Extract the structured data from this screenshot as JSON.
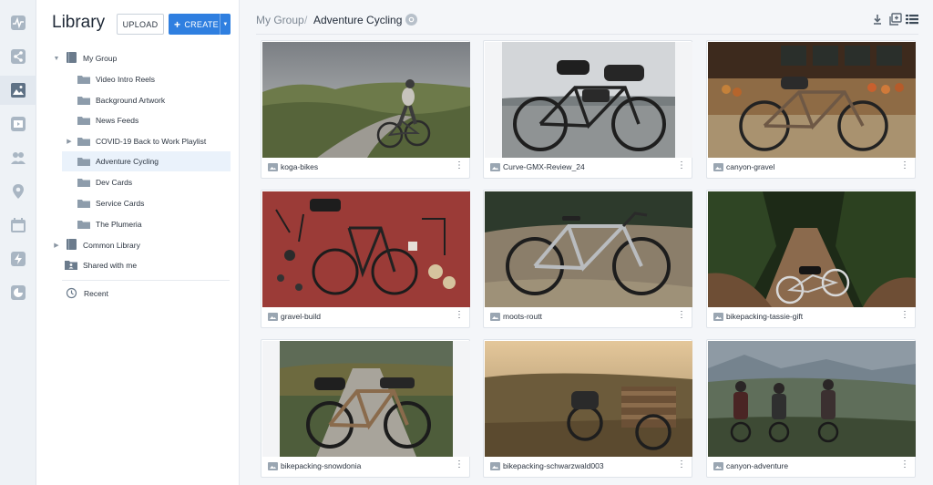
{
  "rail": {
    "items": [
      {
        "icon": "activity-icon"
      },
      {
        "icon": "share-icon"
      },
      {
        "icon": "image-library-icon"
      },
      {
        "icon": "media-icon"
      },
      {
        "icon": "users-icon"
      },
      {
        "icon": "location-pin-icon"
      },
      {
        "icon": "calendar-icon"
      },
      {
        "icon": "lightning-icon"
      },
      {
        "icon": "analytics-icon"
      }
    ],
    "active_index": 2
  },
  "library": {
    "title": "Library",
    "upload_label": "UPLOAD",
    "create_label": "CREATE",
    "tree": [
      {
        "label": "My Group",
        "type": "book",
        "expanded": true
      },
      {
        "label": "Video Intro Reels",
        "type": "folder"
      },
      {
        "label": "Background Artwork",
        "type": "folder"
      },
      {
        "label": "News Feeds",
        "type": "folder"
      },
      {
        "label": "COVID-19 Back to Work Playlist",
        "type": "folder"
      },
      {
        "label": "Adventure Cycling",
        "type": "folder",
        "selected": true
      },
      {
        "label": "Dev Cards",
        "type": "folder"
      },
      {
        "label": "Service Cards",
        "type": "folder"
      },
      {
        "label": "The Plumeria",
        "type": "folder"
      },
      {
        "label": "Common Library",
        "type": "book"
      },
      {
        "label": "Shared with me",
        "type": "shared-folder"
      }
    ],
    "recent_label": "Recent"
  },
  "breadcrumb": {
    "parent": "My Group",
    "separator": "/",
    "current": "Adventure Cycling"
  },
  "colors": {
    "accent": "#2f7fe0",
    "selected_row": "#eaf2fb",
    "icon_gray": "#9aa6b2"
  },
  "assets": [
    {
      "name": "koga-bikes"
    },
    {
      "name": "Curve-GMX-Review_24"
    },
    {
      "name": "canyon-gravel"
    },
    {
      "name": "gravel-build"
    },
    {
      "name": "moots-routt"
    },
    {
      "name": "bikepacking-tassie-gift"
    },
    {
      "name": "bikepacking-snowdonia"
    },
    {
      "name": "bikepacking-schwarzwald003"
    },
    {
      "name": "canyon-adventure"
    }
  ]
}
